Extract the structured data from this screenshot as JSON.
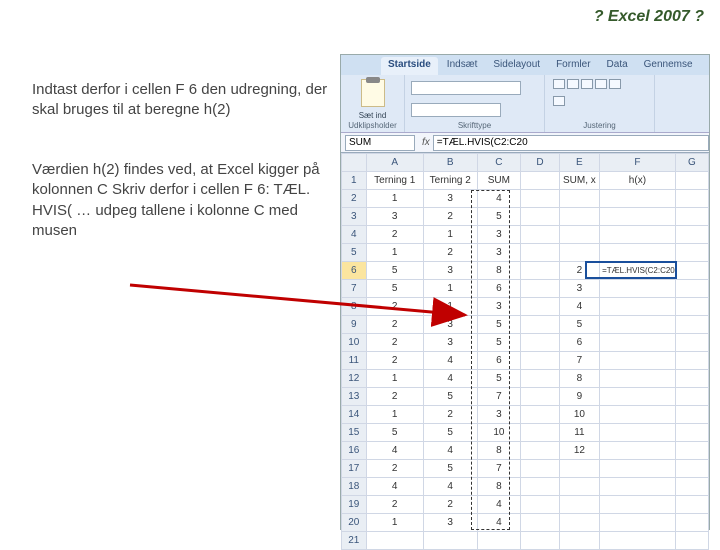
{
  "title": "? Excel 2007 ?",
  "instructions": {
    "p1": "Indtast derfor i cellen F 6 den udregning, der skal bruges til at beregne h(2)",
    "p2": "Værdien h(2) findes ved, at Excel kigger på kolonnen C Skriv derfor i cellen F 6: TÆL. HVIS( … udpeg tallene i kolonne C med musen"
  },
  "ribbon": {
    "tabs": [
      "Startside",
      "Indsæt",
      "Sidelayout",
      "Formler",
      "Data",
      "Gennemse"
    ],
    "active_tab": "Startside",
    "groups": {
      "clipboard": "Udklipsholder",
      "font": "Skrifttype",
      "align": "Justering"
    },
    "paste_label": "Sæt ind"
  },
  "formula_bar": {
    "name_box": "SUM",
    "fx": "fx",
    "formula": "=TÆL.HVIS(C2:C20"
  },
  "columns": [
    "A",
    "B",
    "C",
    "D",
    "E",
    "F",
    "G"
  ],
  "headers_row1": {
    "A": "Terning 1",
    "B": "Terning 2",
    "C": "SUM",
    "E": "SUM, x",
    "F": "h(x)"
  },
  "active_cell_text": "=TÆL.HVIS(C2:C20",
  "chart_data": {
    "type": "table",
    "columns": [
      "row",
      "Terning 1",
      "Terning 2",
      "SUM",
      "SUM_x",
      "h_x"
    ],
    "rows": [
      [
        1,
        null,
        null,
        null,
        null,
        null
      ],
      [
        2,
        1,
        3,
        4,
        null,
        null
      ],
      [
        3,
        3,
        2,
        5,
        null,
        null
      ],
      [
        4,
        2,
        1,
        3,
        null,
        null
      ],
      [
        5,
        1,
        2,
        3,
        null,
        null
      ],
      [
        6,
        5,
        3,
        8,
        2,
        "=TÆL.HVIS(C2:C20"
      ],
      [
        7,
        5,
        1,
        6,
        3,
        null
      ],
      [
        8,
        2,
        1,
        3,
        4,
        null
      ],
      [
        9,
        2,
        3,
        5,
        5,
        null
      ],
      [
        10,
        2,
        3,
        5,
        6,
        null
      ],
      [
        11,
        2,
        4,
        6,
        7,
        null
      ],
      [
        12,
        1,
        4,
        5,
        8,
        null
      ],
      [
        13,
        2,
        5,
        7,
        9,
        null
      ],
      [
        14,
        1,
        2,
        3,
        10,
        null
      ],
      [
        15,
        5,
        5,
        10,
        11,
        null
      ],
      [
        16,
        4,
        4,
        8,
        12,
        null
      ],
      [
        17,
        2,
        5,
        7,
        null,
        null
      ],
      [
        18,
        4,
        4,
        8,
        null,
        null
      ],
      [
        19,
        2,
        2,
        4,
        null,
        null
      ],
      [
        20,
        1,
        3,
        4,
        null,
        null
      ],
      [
        21,
        null,
        null,
        null,
        null,
        null
      ]
    ]
  }
}
